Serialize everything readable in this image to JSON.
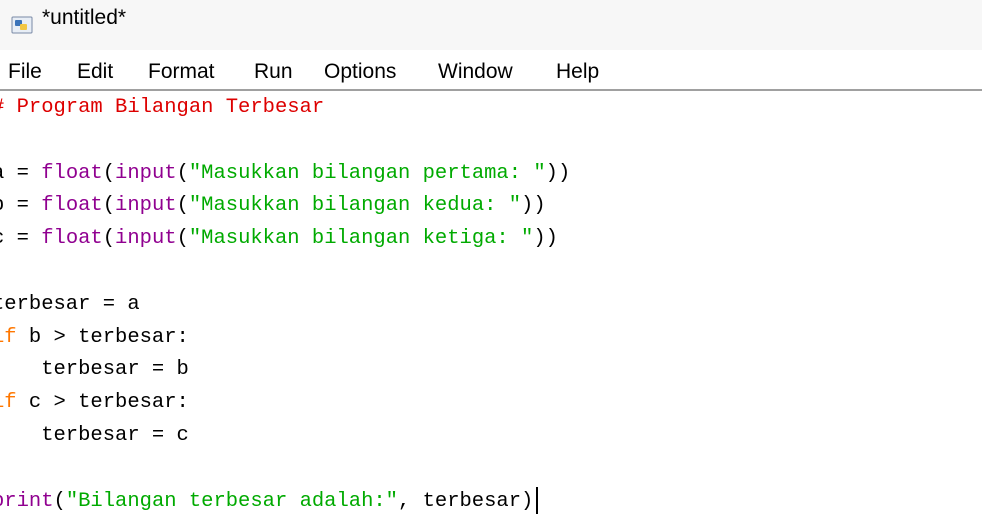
{
  "window": {
    "title": "*untitled*",
    "icon": "python-idle-icon"
  },
  "menu": {
    "items": [
      "File",
      "Edit",
      "Format",
      "Run",
      "Options",
      "Window",
      "Help"
    ]
  },
  "editor": {
    "lines": [
      [
        {
          "t": "# Program Bilangan Terbesar",
          "c": "comment"
        }
      ],
      [],
      [
        {
          "t": "a = ",
          "c": "plain"
        },
        {
          "t": "float",
          "c": "builtin"
        },
        {
          "t": "(",
          "c": "plain"
        },
        {
          "t": "input",
          "c": "builtin"
        },
        {
          "t": "(",
          "c": "plain"
        },
        {
          "t": "\"Masukkan bilangan pertama: \"",
          "c": "string"
        },
        {
          "t": "))",
          "c": "plain"
        }
      ],
      [
        {
          "t": "b = ",
          "c": "plain"
        },
        {
          "t": "float",
          "c": "builtin"
        },
        {
          "t": "(",
          "c": "plain"
        },
        {
          "t": "input",
          "c": "builtin"
        },
        {
          "t": "(",
          "c": "plain"
        },
        {
          "t": "\"Masukkan bilangan kedua: \"",
          "c": "string"
        },
        {
          "t": "))",
          "c": "plain"
        }
      ],
      [
        {
          "t": "c = ",
          "c": "plain"
        },
        {
          "t": "float",
          "c": "builtin"
        },
        {
          "t": "(",
          "c": "plain"
        },
        {
          "t": "input",
          "c": "builtin"
        },
        {
          "t": "(",
          "c": "plain"
        },
        {
          "t": "\"Masukkan bilangan ketiga: \"",
          "c": "string"
        },
        {
          "t": "))",
          "c": "plain"
        }
      ],
      [],
      [
        {
          "t": "terbesar = a",
          "c": "plain"
        }
      ],
      [
        {
          "t": "if",
          "c": "keyword"
        },
        {
          "t": " b > terbesar:",
          "c": "plain"
        }
      ],
      [
        {
          "t": "    terbesar = b",
          "c": "plain"
        }
      ],
      [
        {
          "t": "if",
          "c": "keyword"
        },
        {
          "t": " c > terbesar:",
          "c": "plain"
        }
      ],
      [
        {
          "t": "    terbesar = c",
          "c": "plain"
        }
      ],
      [],
      [
        {
          "t": "print",
          "c": "builtin"
        },
        {
          "t": "(",
          "c": "plain"
        },
        {
          "t": "\"Bilangan terbesar adalah:\"",
          "c": "string"
        },
        {
          "t": ", terbesar)",
          "c": "plain"
        }
      ]
    ],
    "cursor_line": 13
  }
}
